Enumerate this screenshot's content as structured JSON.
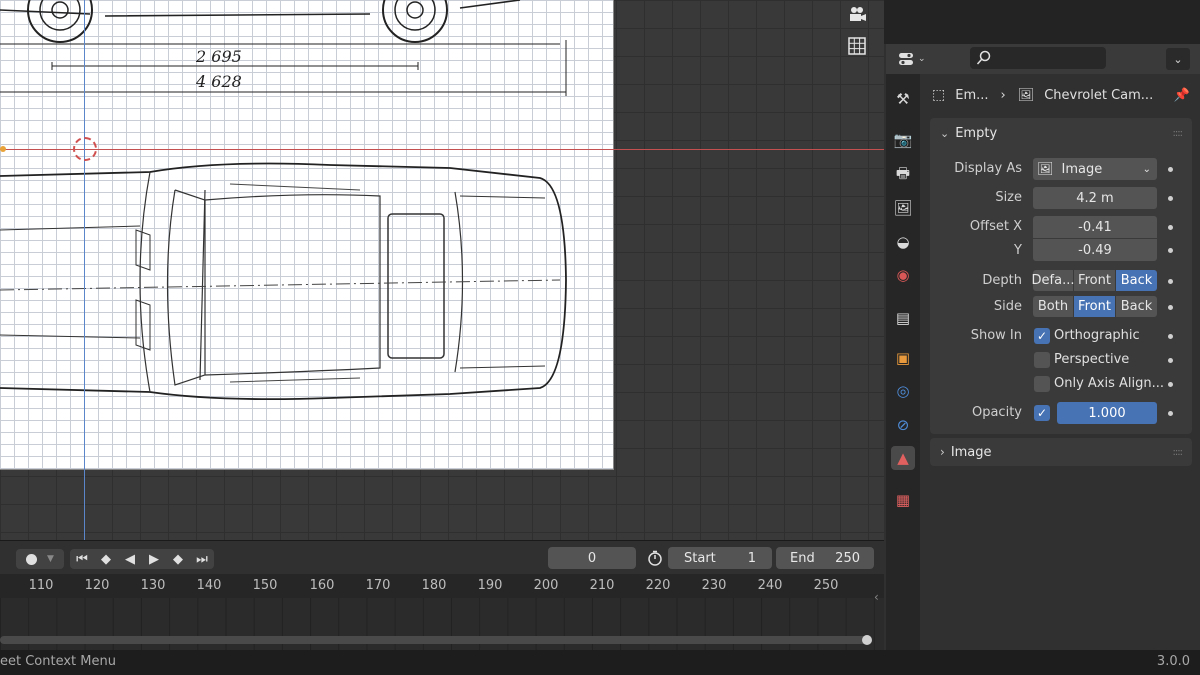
{
  "viewport": {
    "dim_wheelbase": "2 695",
    "dim_length": "4 628"
  },
  "timeline": {
    "current_frame": "0",
    "start_label": "Start",
    "start_value": "1",
    "end_label": "End",
    "end_value": "250",
    "ruler": [
      "110",
      "120",
      "130",
      "140",
      "150",
      "160",
      "170",
      "180",
      "190",
      "200",
      "210",
      "220",
      "230",
      "240",
      "250"
    ]
  },
  "statusbar": {
    "hint": "eet Context Menu",
    "version": "3.0.0"
  },
  "properties": {
    "breadcrumb_object": "Em...",
    "breadcrumb_data": "Chevrolet Cam...",
    "empty_panel": {
      "title": "Empty",
      "display_as_label": "Display As",
      "display_as_value": "Image",
      "size_label": "Size",
      "size_value": "4.2 m",
      "offset_x_label": "Offset X",
      "offset_x_value": "-0.41",
      "offset_y_label": "Y",
      "offset_y_value": "-0.49",
      "depth_label": "Depth",
      "depth_options": [
        "Defa...",
        "Front",
        "Back"
      ],
      "depth_selected": "Back",
      "side_label": "Side",
      "side_options": [
        "Both",
        "Front",
        "Back"
      ],
      "side_selected": "Front",
      "show_in_label": "Show In",
      "show_in_options": [
        {
          "label": "Orthographic",
          "checked": true
        },
        {
          "label": "Perspective",
          "checked": false
        },
        {
          "label": "Only Axis Align...",
          "checked": false
        }
      ],
      "opacity_label": "Opacity",
      "opacity_value": "1.000"
    },
    "image_panel": {
      "title": "Image"
    }
  },
  "colors": {
    "accent": "#4772b3",
    "panel": "#3a3a3a",
    "background": "#303030"
  }
}
